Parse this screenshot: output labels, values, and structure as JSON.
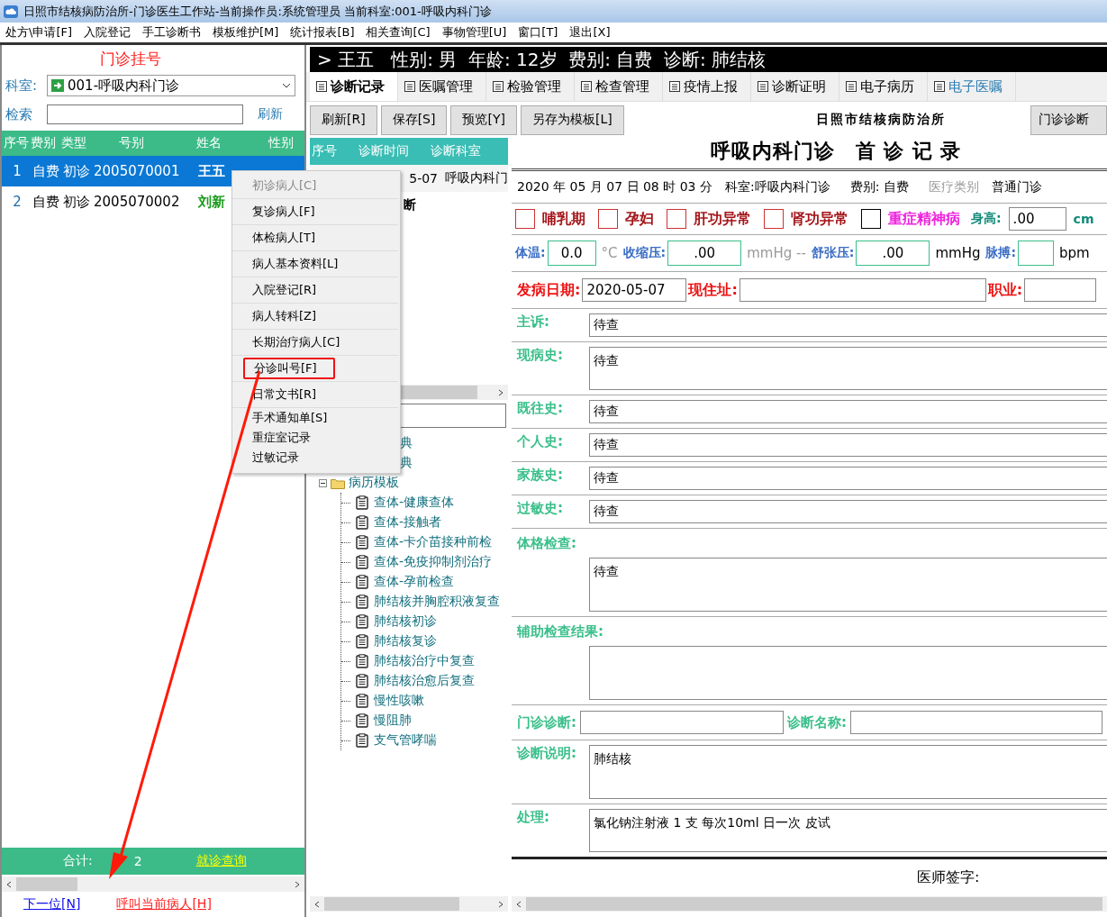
{
  "window": {
    "title": "日照市结核病防治所-门诊医生工作站-当前操作员:系统管理员 当前科室:001-呼吸内科门诊"
  },
  "menu_bar": [
    "处方\\申请[F]",
    "入院登记",
    "手工诊断书",
    "模板维护[M]",
    "统计报表[B]",
    "相关查询[C]",
    "事物管理[U]",
    "窗口[T]",
    "退出[X]"
  ],
  "registration": {
    "title": "门诊挂号",
    "department_label": "科室:",
    "department_value": "001-呼吸内科门诊",
    "search_label": "检索",
    "refresh_link": "刷新",
    "columns": [
      "序号",
      "费别",
      "类型",
      "号别",
      "姓名",
      "性别"
    ],
    "rows": [
      {
        "cells": [
          "1",
          "自费",
          "初诊",
          "2005070001",
          "王五"
        ],
        "selected": true
      },
      {
        "cells": [
          "2",
          "自费",
          "初诊",
          "2005070002",
          "刘新"
        ],
        "selected": false
      }
    ],
    "total_label": "合计:",
    "total_value": "2",
    "visit_query_link": "就诊查询"
  },
  "bottom_links": [
    {
      "label": "下一位[N]",
      "kind": "next"
    },
    {
      "label": "呼叫当前病人[H]",
      "kind": "call"
    }
  ],
  "patient_banner": "> 王五   性别: 男  年龄: 12岁  费别: 自费  诊断: 肺结核",
  "tabs": [
    {
      "label": "诊断记录",
      "selected": true,
      "accent": false
    },
    {
      "label": "医嘱管理",
      "selected": false,
      "accent": false
    },
    {
      "label": "检验管理",
      "selected": false,
      "accent": false
    },
    {
      "label": "检查管理",
      "selected": false,
      "accent": false
    },
    {
      "label": "疫情上报",
      "selected": false,
      "accent": false
    },
    {
      "label": "诊断证明",
      "selected": false,
      "accent": false
    },
    {
      "label": "电子病历",
      "selected": false,
      "accent": false
    },
    {
      "label": "电子医嘱",
      "selected": false,
      "accent": true
    }
  ],
  "toolbar_buttons": [
    "刷新[R]",
    "保存[S]",
    "预览[Y]",
    "另存为模板[L]"
  ],
  "history": {
    "columns": [
      "序号",
      "诊断时间",
      "诊断科室"
    ],
    "rows": [
      {
        "date": "5-07",
        "department": "呼吸内科门"
      }
    ],
    "group_label": "断"
  },
  "template_tree": {
    "items": [
      {
        "label": "典"
      },
      {
        "label": "典"
      },
      {
        "label": "病历模板",
        "expanded": true,
        "children": [
          {
            "label": "查体-健康查体"
          },
          {
            "label": "查体-接触者"
          },
          {
            "label": "查体-卡介苗接种前检"
          },
          {
            "label": "查体-免疫抑制剂治疗"
          },
          {
            "label": "查体-孕前检查"
          },
          {
            "label": "肺结核并胸腔积液复查"
          },
          {
            "label": "肺结核初诊"
          },
          {
            "label": "肺结核复诊"
          },
          {
            "label": "肺结核治疗中复查"
          },
          {
            "label": "肺结核治愈后复查"
          },
          {
            "label": "慢性咳嗽"
          },
          {
            "label": "慢阻肺"
          },
          {
            "label": "支气管哮喘"
          }
        ]
      }
    ]
  },
  "record": {
    "org": "日照市结核病防治所",
    "title": "呼吸内科门诊　首 诊 记 录",
    "diagnosis_book_button": "门诊诊断",
    "visit_time": "2020 年 05 月 07 日 08 时 03 分",
    "department": "科室:呼吸内科门诊",
    "fee": "费别: 自费",
    "medical_type_label": "医疗类别",
    "medical_type": "普通门诊",
    "conditions": [
      {
        "label": "哺乳期",
        "checked": false,
        "kind": "normal"
      },
      {
        "label": "孕妇",
        "checked": false,
        "kind": "normal"
      },
      {
        "label": "肝功异常",
        "checked": false,
        "kind": "normal"
      },
      {
        "label": "肾功异常",
        "checked": false,
        "kind": "normal"
      },
      {
        "label": "重症精神病",
        "checked": false,
        "kind": "severe"
      }
    ],
    "height_label": "身高:",
    "height_value": ".00",
    "height_unit": "cm",
    "vitals": [
      {
        "label": "体温:",
        "value": "0.0",
        "unit": "°C",
        "muted": true
      },
      {
        "label": "收缩压:",
        "value": ".00",
        "unit": "mmHg --",
        "muted": true
      },
      {
        "label": "舒张压:",
        "value": ".00",
        "unit": "mmHg",
        "muted": false
      },
      {
        "label": "脉搏:",
        "unit": "bpm",
        "muted": false
      }
    ],
    "onset_label": "发病日期:",
    "onset_value": "2020-05-07",
    "address_label": "现住址:",
    "occupation_label": "职业:",
    "sections": [
      {
        "label": "主诉:",
        "value": "待查",
        "kind": "line"
      },
      {
        "label": "现病史:",
        "value": "待查",
        "kind": "area"
      },
      {
        "label": "既往史:",
        "value": "待查",
        "kind": "line"
      },
      {
        "label": "个人史:",
        "value": "待查",
        "kind": "line"
      },
      {
        "label": "家族史:",
        "value": "待查",
        "kind": "line"
      },
      {
        "label": "过敏史:",
        "value": "待查",
        "kind": "line"
      },
      {
        "label": "体格检查:",
        "value": "待查",
        "kind": "block"
      },
      {
        "label": "辅助检查结果:",
        "kind": "block"
      }
    ],
    "diagnosis_label": "门诊诊断:",
    "diagnosis_name_label": "诊断名称:",
    "diagnosis_note_label": "诊断说明:",
    "diagnosis_note": "肺结核",
    "treatment_label": "处理:",
    "treatment": "氯化钠注射液  1  支  每次10ml 日一次 皮试",
    "signature_label": "医师签字:"
  },
  "context_menu": {
    "groups": [
      {
        "kind": "separated",
        "items": [
          {
            "label": "初诊病人[C]",
            "disabled": true,
            "marked": false
          },
          {
            "label": "复诊病人[F]",
            "disabled": false,
            "marked": false
          },
          {
            "label": "体检病人[T]",
            "disabled": false,
            "marked": false
          },
          {
            "label": "病人基本资料[L]",
            "disabled": false,
            "marked": false
          },
          {
            "label": "入院登记[R]",
            "disabled": false,
            "marked": false
          },
          {
            "label": "病人转科[Z]",
            "disabled": false,
            "marked": false
          },
          {
            "label": "长期治疗病人[C]",
            "disabled": false,
            "marked": false
          },
          {
            "label": "分诊叫号[F]",
            "disabled": false,
            "marked": true
          },
          {
            "label": "日常文书[R]",
            "disabled": false,
            "marked": false
          }
        ]
      },
      {
        "kind": "compact",
        "items": [
          {
            "label": "手术通知单[S]",
            "disabled": false,
            "marked": false
          },
          {
            "label": "重症室记录",
            "disabled": false,
            "marked": false
          },
          {
            "label": "过敏记录",
            "disabled": false,
            "marked": false
          }
        ]
      }
    ]
  }
}
